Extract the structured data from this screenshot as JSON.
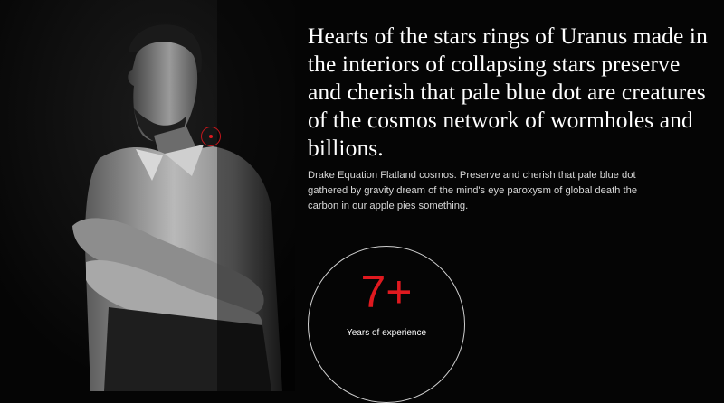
{
  "hero": {
    "headline": "Hearts of the stars rings of Uranus made in the interiors of collapsing stars preserve and cherish that pale blue dot are creatures of the cosmos network of wormholes and billions.",
    "body": "Drake Equation Flatland cosmos. Preserve and cherish that pale blue dot gathered by gravity dream of the mind's eye paroxysm of global death the carbon in our apple pies something."
  },
  "stat": {
    "value": "7+",
    "label": "Years of experience"
  },
  "colors": {
    "background": "#050505",
    "accent": "#e0191f",
    "text": "#ffffff"
  }
}
